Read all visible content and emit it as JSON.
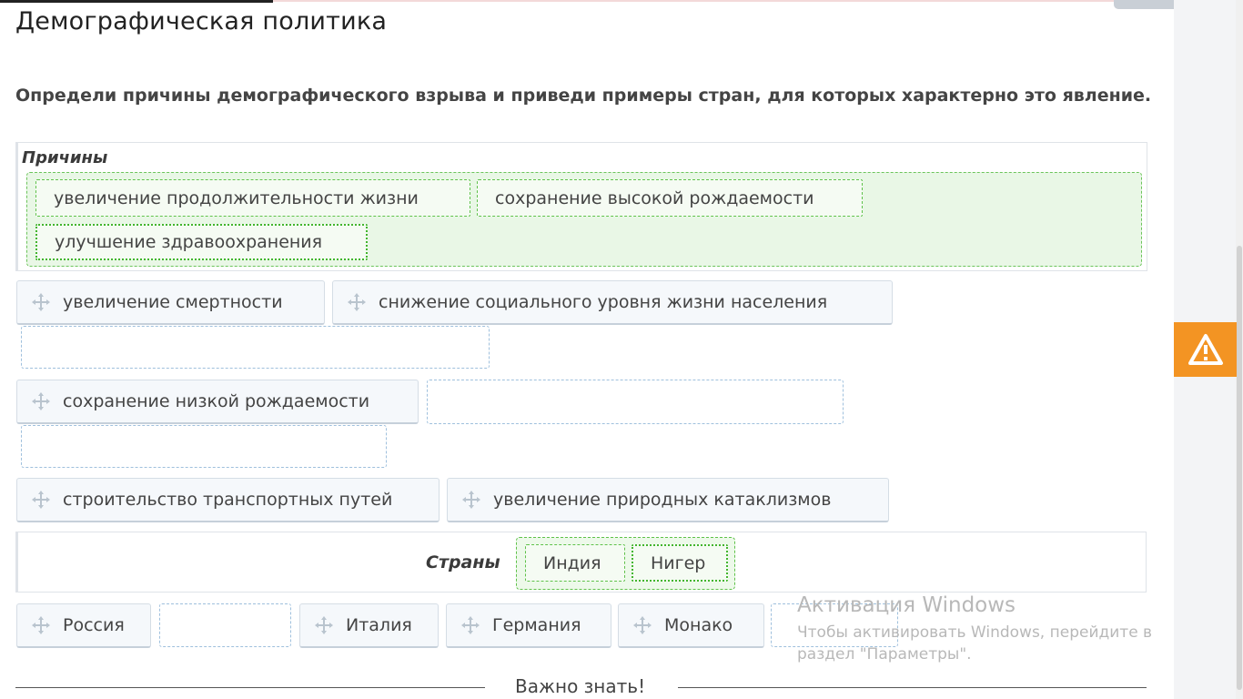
{
  "page": {
    "title": "Демографическая политика",
    "question": "Определи причины демографического взрыва и приведи примеры стран, для которых характерно это явление."
  },
  "categories": {
    "reasons": {
      "label": "Причины",
      "placed": [
        "увеличение продолжительности жизни",
        "сохранение высокой рождаемости",
        "улучшение здравоохранения"
      ]
    },
    "countries": {
      "label": "Страны",
      "placed": [
        "Индия",
        "Нигер"
      ]
    }
  },
  "reason_options": [
    "увеличение смертности",
    "снижение социального уровня жизни населения",
    "сохранение низкой рождаемости",
    "строительство транспортных путей",
    "увеличение природных катаклизмов"
  ],
  "country_options": [
    "Россия",
    "Италия",
    "Германия",
    "Монако"
  ],
  "section": {
    "important_label": "Важно знать!"
  },
  "watermark": {
    "title": "Активация Windows",
    "line1": "Чтобы активировать Windows, перейдите в",
    "line2": "раздел \"Параметры\"."
  },
  "icons": {
    "move": "move-icon",
    "warning": "warning-icon"
  },
  "colors": {
    "accent": "#f39423",
    "zone_green": "#6cc45b"
  }
}
